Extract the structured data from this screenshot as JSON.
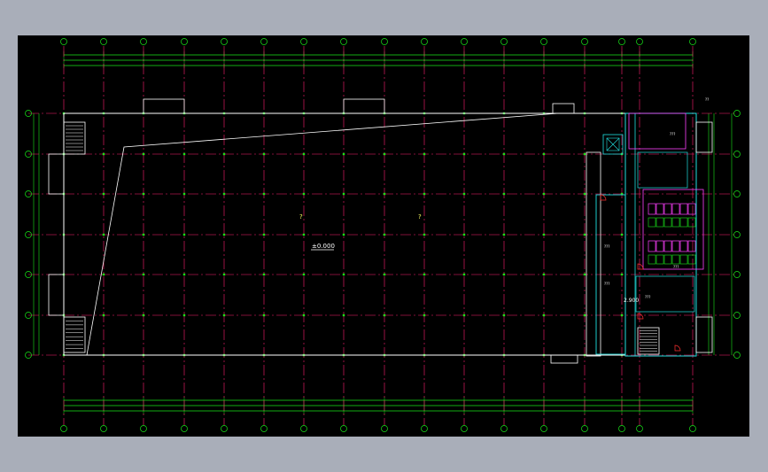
{
  "drawing": {
    "elevation_label": "±0.000",
    "room_marks": [
      "?",
      "?"
    ],
    "dim_label": "2.900",
    "small_labels": [
      "???",
      "???",
      "???",
      "???",
      "???",
      "??"
    ]
  },
  "colors": {
    "background": "#000000",
    "axis": "#ff1f6f",
    "wall": "#ffffff",
    "dimension": "#19e619",
    "detail_cyan": "#20e0e0",
    "detail_magenta": "#ff40ff",
    "window_frame": "#a9aeb9"
  }
}
